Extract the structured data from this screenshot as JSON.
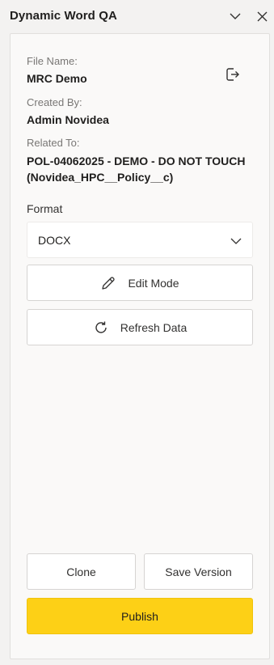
{
  "window": {
    "title": "Dynamic Word QA"
  },
  "details": {
    "file_name_label": "File Name:",
    "file_name": "MRC Demo",
    "created_by_label": "Created By:",
    "created_by": "Admin Novidea",
    "related_to_label": "Related To:",
    "related_to": "POL-04062025 - DEMO - DO NOT TOUCH (Novidea_HPC__Policy__c)"
  },
  "format": {
    "label": "Format",
    "selected": "DOCX"
  },
  "actions": {
    "edit_mode": "Edit Mode",
    "refresh_data": "Refresh Data",
    "clone": "Clone",
    "save_version": "Save Version",
    "publish": "Publish"
  },
  "colors": {
    "publish_bg": "#fdd016",
    "panel_bg": "#faf9f8",
    "page_bg": "#f3f2f1"
  },
  "icons": {
    "collapse": "chevron-down-icon",
    "close": "close-icon",
    "open_file": "open-external-icon",
    "dropdown": "chevron-down-icon",
    "edit": "pencil-icon",
    "refresh": "refresh-icon"
  }
}
